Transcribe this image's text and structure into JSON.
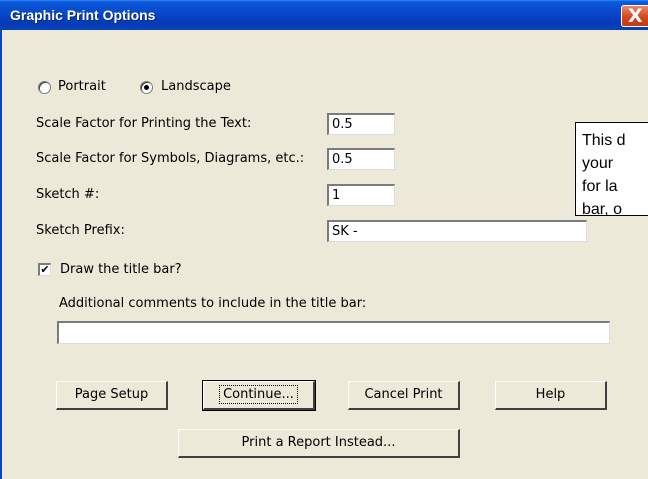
{
  "window": {
    "title": "Graphic Print Options",
    "close_glyph": "X"
  },
  "orientation": {
    "options": [
      {
        "label": "Portrait",
        "selected": false
      },
      {
        "label": "Landscape",
        "selected": true
      }
    ]
  },
  "fields": {
    "scale_text": {
      "label": "Scale Factor for Printing the Text:",
      "value": "0.5"
    },
    "scale_symbols": {
      "label": "Scale Factor for Symbols, Diagrams, etc.:",
      "value": "0.5"
    },
    "sketch_number": {
      "label": "Sketch #:",
      "value": "1"
    },
    "sketch_prefix": {
      "label": "Sketch Prefix:",
      "value": "SK -"
    }
  },
  "title_bar_option": {
    "label": "Draw the title bar?",
    "checked": true,
    "check_glyph": "✔"
  },
  "comments": {
    "label": "Additional comments to include in the title bar:",
    "value": ""
  },
  "buttons": {
    "page_setup": "Page Setup",
    "continue": "Continue...",
    "cancel_print": "Cancel Print",
    "help": "Help",
    "print_report": "Print a Report Instead..."
  },
  "tooltip": {
    "lines": [
      "This d",
      "your",
      "for la",
      "bar, o"
    ]
  },
  "colors": {
    "titlebar": "#0846c8",
    "dialog_bg": "#ece9d8",
    "close_button": "#d4461e"
  }
}
